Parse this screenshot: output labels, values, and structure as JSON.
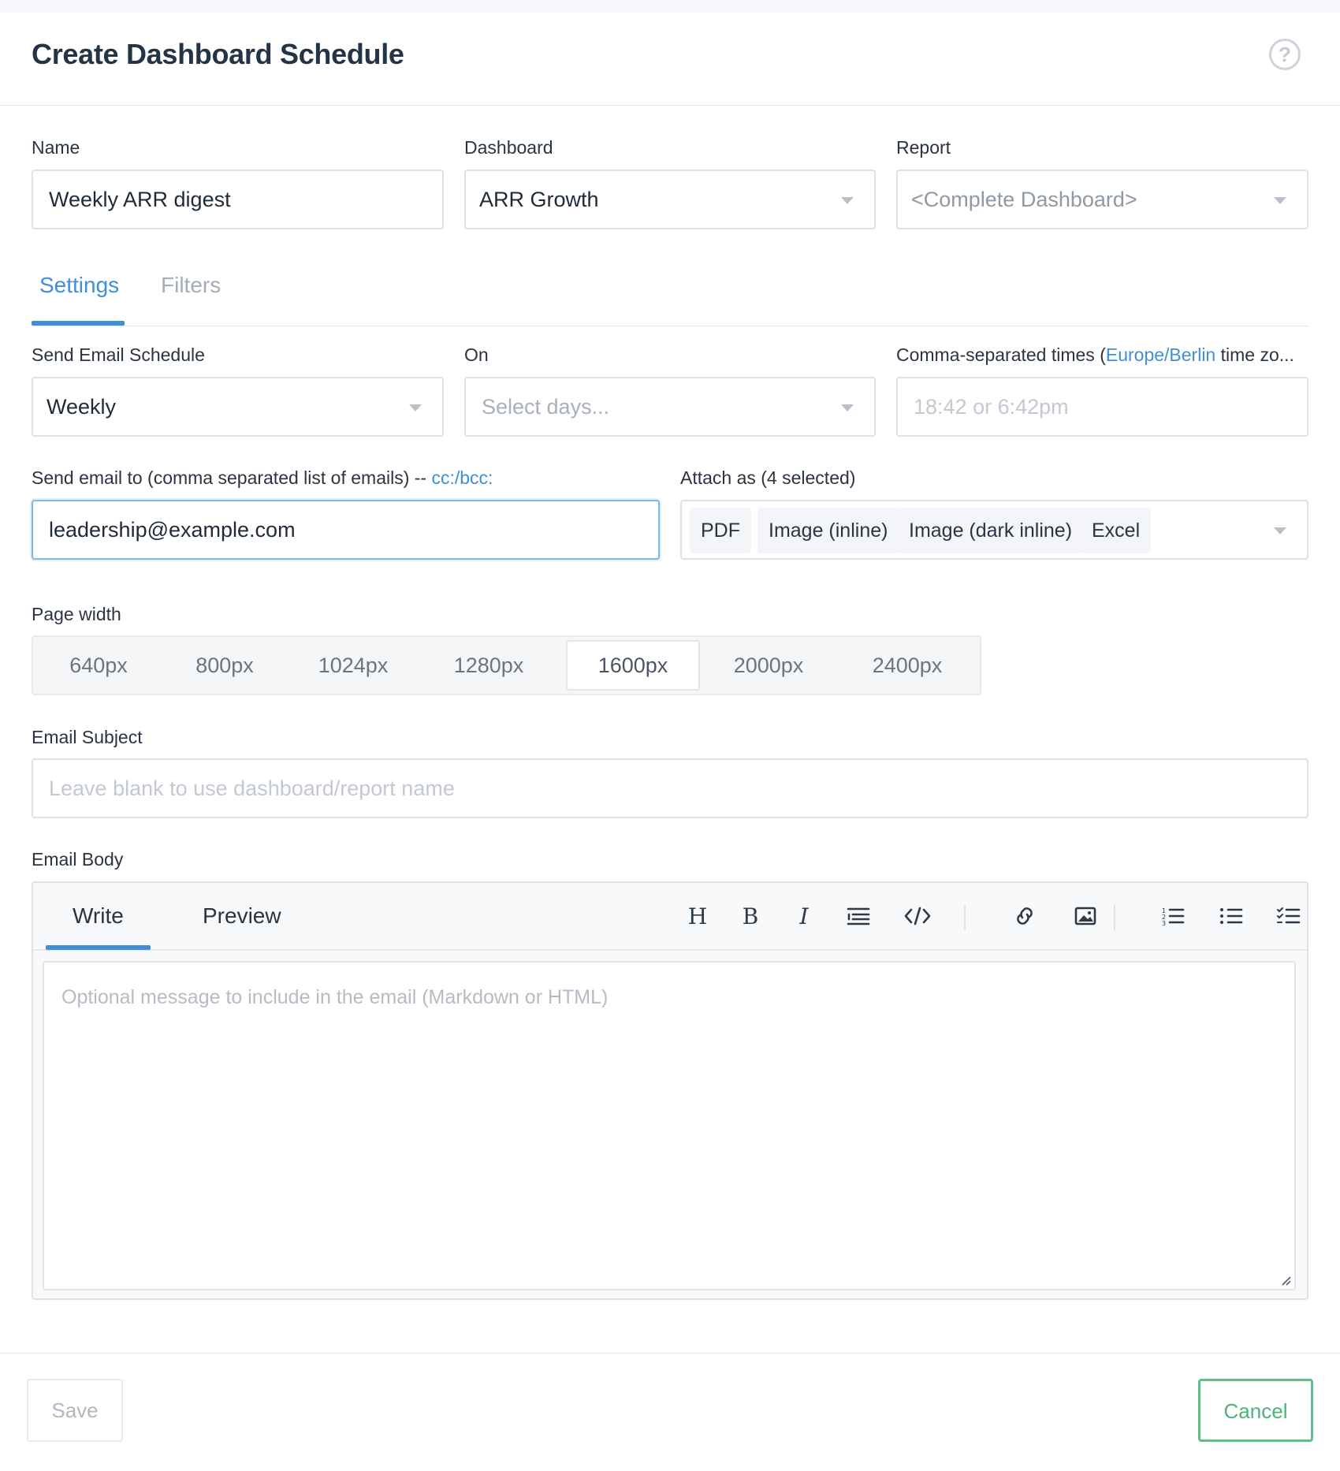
{
  "header": {
    "title": "Create Dashboard Schedule",
    "help_icon": "question-circle-icon"
  },
  "form": {
    "name": {
      "label": "Name",
      "value": "Weekly ARR digest"
    },
    "dashboard": {
      "label": "Dashboard",
      "value": "ARR Growth"
    },
    "report": {
      "label": "Report",
      "placeholder": "<Complete Dashboard>"
    }
  },
  "tabs": [
    {
      "label": "Settings",
      "active": true
    },
    {
      "label": "Filters",
      "active": false
    }
  ],
  "settings": {
    "schedule": {
      "label": "Send Email Schedule",
      "value": "Weekly"
    },
    "on": {
      "label": "On",
      "placeholder": "Select days..."
    },
    "times": {
      "label_prefix": "Comma-separated times (",
      "timezone": "Europe/Berlin",
      "label_suffix": " time zo...",
      "placeholder": "18:42 or 6:42pm"
    },
    "recipients": {
      "label": "Send email to (comma separated list of emails) --",
      "cc_link": "cc:/bcc:",
      "value": "leadership@example.com"
    },
    "attach": {
      "label": "Attach as (4 selected)",
      "chips": [
        "PDF",
        "Image (inline)",
        "Image (dark inline)",
        "Excel"
      ]
    },
    "page_width": {
      "label": "Page width",
      "options": [
        "640px",
        "800px",
        "1024px",
        "1280px",
        "1600px",
        "2000px",
        "2400px"
      ],
      "selected": "1600px"
    },
    "subject": {
      "label": "Email Subject",
      "placeholder": "Leave blank to use dashboard/report name"
    },
    "body": {
      "label": "Email Body",
      "tabs": [
        "Write",
        "Preview"
      ],
      "active_tab": "Write",
      "placeholder": "Optional message to include in the email (Markdown or HTML)",
      "toolbar": [
        "heading-icon",
        "bold-icon",
        "italic-icon",
        "quote-icon",
        "code-icon",
        "link-icon",
        "image-icon",
        "ordered-list-icon",
        "unordered-list-icon",
        "task-list-icon"
      ]
    }
  },
  "footer": {
    "save_label": "Save",
    "cancel_label": "Cancel"
  },
  "colors": {
    "accent": "#3f8fd6",
    "cancel": "#4bb37d",
    "border": "#dde2e8"
  }
}
